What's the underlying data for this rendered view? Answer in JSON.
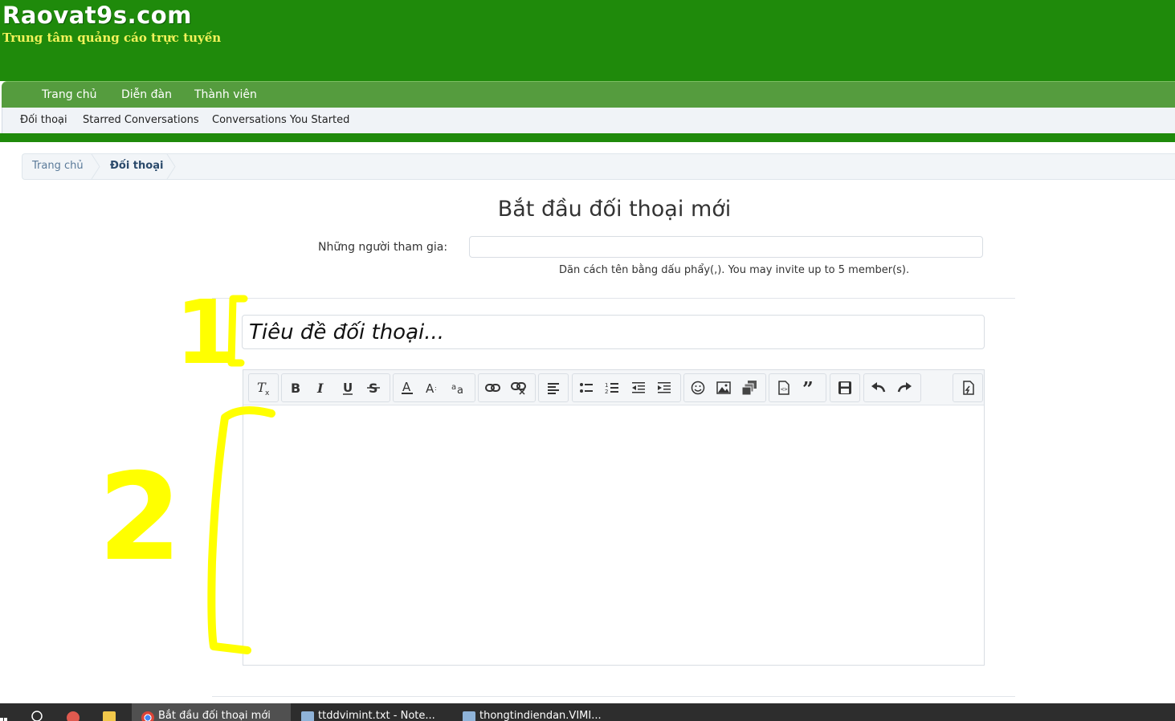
{
  "header": {
    "site_name": "Raovat9s.com",
    "tagline": "Trung tâm quảng cáo trực tuyến"
  },
  "nav": {
    "tabs": [
      "Trang chủ",
      "Diễn đàn",
      "Thành viên"
    ]
  },
  "subnav": {
    "links": [
      "Đối thoại",
      "Starred Conversations",
      "Conversations You Started"
    ]
  },
  "breadcrumb": {
    "items": [
      "Trang chủ",
      "Đối thoại"
    ]
  },
  "form": {
    "page_title": "Bắt đầu đối thoại mới",
    "participants_label": "Những người tham gia:",
    "participants_value": "",
    "participants_hint": "Dãn cách tên bằng dấu phẩy(,). You may invite up to 5 member(s).",
    "title_placeholder": "Tiêu đề đối thoại...",
    "message_body": ""
  },
  "toolbar": {
    "buttons": [
      "remove-format",
      "bold",
      "italic",
      "underline",
      "strikethrough",
      "text-color",
      "font-size",
      "font-family",
      "link",
      "unlink",
      "align",
      "bulleted-list",
      "numbered-list",
      "outdent",
      "indent",
      "smilies",
      "image",
      "media",
      "insert-code",
      "quote",
      "save-draft",
      "undo",
      "redo",
      "toggle-bbcode"
    ]
  },
  "annotations": {
    "marker_1": "1",
    "marker_2": "2",
    "color": "#ffff00"
  },
  "taskbar": {
    "items": [
      "Bắt đầu đối thoại mới",
      "ttddvimint.txt - Note...",
      "thongtindiendan.VIMI..."
    ]
  },
  "colors": {
    "header_green": "#1f8a0b",
    "nav_green": "#559c3e",
    "tagline_yellow": "#f2f25a"
  }
}
